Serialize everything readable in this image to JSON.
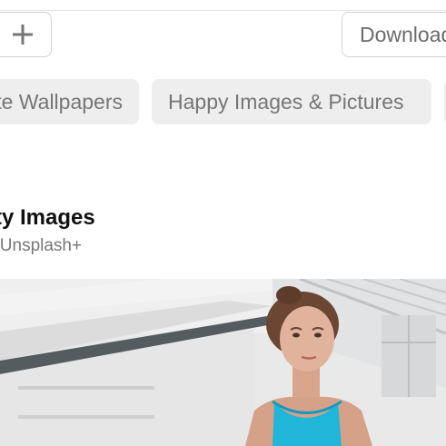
{
  "toolbar": {
    "add_icon": "plus-icon",
    "download_label": "Download"
  },
  "tags": [
    {
      "label": "Cute Wallpapers"
    },
    {
      "label": "Happy Images & Pictures"
    },
    {
      "label": ""
    }
  ],
  "sponsor": {
    "title": "Getty Images",
    "subtitle": "For Unsplash+"
  },
  "photo": {
    "description_icon": "photo-image"
  },
  "colors": {
    "chip_bg": "#eeeeee",
    "border": "#d1d1d1",
    "text_muted": "#767676",
    "leotard": "#1fb6d9"
  }
}
